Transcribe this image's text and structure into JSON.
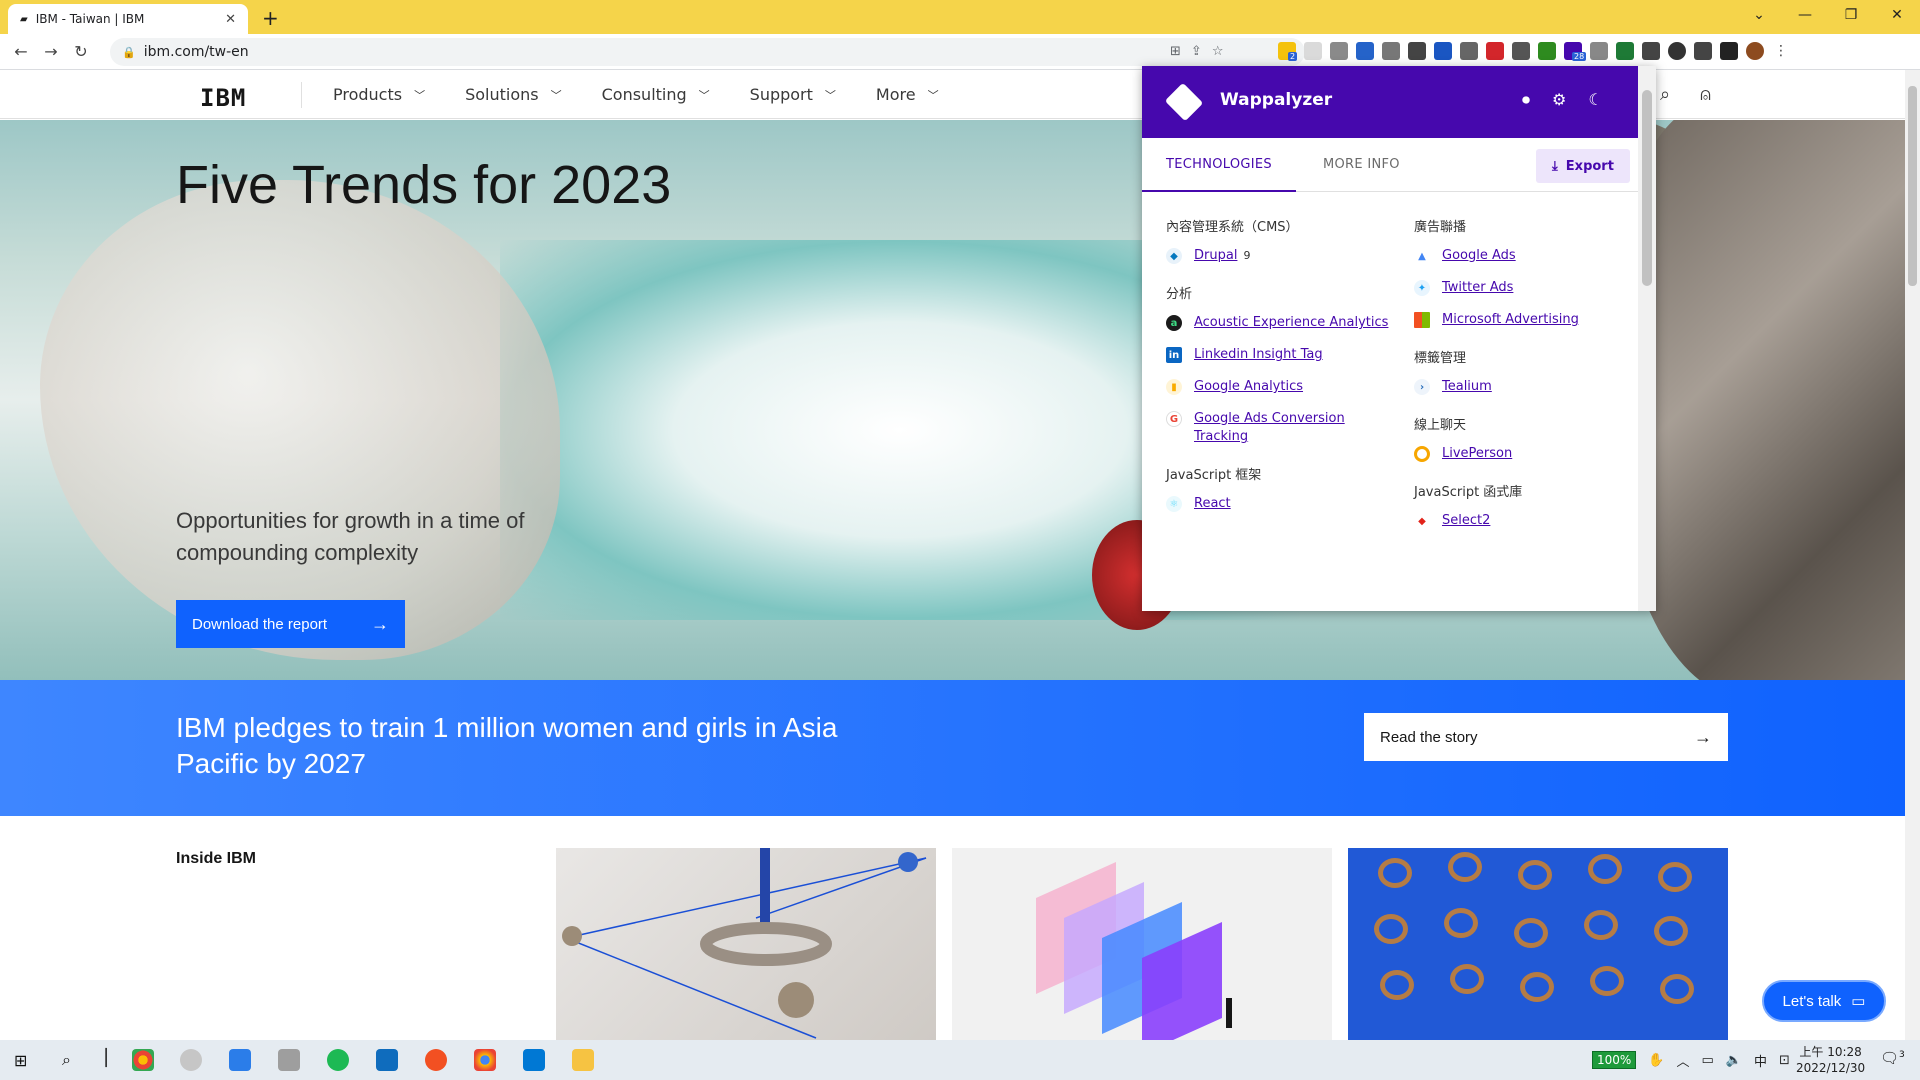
{
  "browser": {
    "tab_title": "IBM - Taiwan | IBM",
    "tab_close": "✕",
    "new_tab": "+",
    "url": "ibm.com/tw-en",
    "extension_badges": [
      "2",
      "28"
    ]
  },
  "ibm_nav": {
    "logo": "IBM",
    "items": [
      {
        "label": "Products"
      },
      {
        "label": "Solutions"
      },
      {
        "label": "Consulting"
      },
      {
        "label": "Support"
      },
      {
        "label": "More"
      }
    ]
  },
  "hero": {
    "title": "Five Trends for 2023",
    "subtitle": "Opportunities for growth in a time of compounding complexity",
    "cta_label": "Download the report"
  },
  "band": {
    "text": "IBM pledges to train 1 million women and girls in Asia Pacific by 2027",
    "cta_label": "Read the story"
  },
  "inside": {
    "heading": "Inside IBM"
  },
  "lets_talk": "Let's talk",
  "wappalyzer": {
    "title": "Wappalyzer",
    "tabs": [
      "TECHNOLOGIES",
      "MORE INFO"
    ],
    "export_label": "Export",
    "left_column": [
      {
        "category": "內容管理系統（CMS）",
        "techs": [
          {
            "name": "Drupal",
            "version": "9",
            "icon_color": "#0678be"
          }
        ]
      },
      {
        "category": "分析",
        "techs": [
          {
            "name": "Acoustic Experience Analytics",
            "icon_color": "#1b1b1b"
          },
          {
            "name": "Linkedin Insight Tag",
            "icon_color": "#0a66c2"
          },
          {
            "name": "Google Analytics",
            "icon_color": "#f9ab00"
          },
          {
            "name": "Google Ads Conversion Tracking",
            "icon_color": "#ea4335"
          }
        ]
      },
      {
        "category": "JavaScript 框架",
        "techs": [
          {
            "name": "React",
            "icon_color": "#61dafb"
          }
        ]
      }
    ],
    "right_column": [
      {
        "category": "廣告聯播",
        "techs": [
          {
            "name": "Google Ads",
            "icon_color": "#4285f4"
          },
          {
            "name": "Twitter Ads",
            "icon_color": "#1da1f2"
          },
          {
            "name": "Microsoft Advertising",
            "icon_color": "#f25022"
          }
        ]
      },
      {
        "category": "標籤管理",
        "techs": [
          {
            "name": "Tealium",
            "icon_color": "#2a6ebb"
          }
        ]
      },
      {
        "category": "線上聊天",
        "techs": [
          {
            "name": "LivePerson",
            "icon_color": "#f7a600"
          }
        ]
      },
      {
        "category": "JavaScript 函式庫",
        "techs": [
          {
            "name": "Select2",
            "icon_color": "#e2231a"
          }
        ]
      }
    ]
  },
  "taskbar": {
    "battery": "100%",
    "ime": "中",
    "time": "上午 10:28",
    "date": "2022/12/30",
    "notifications": "3"
  }
}
